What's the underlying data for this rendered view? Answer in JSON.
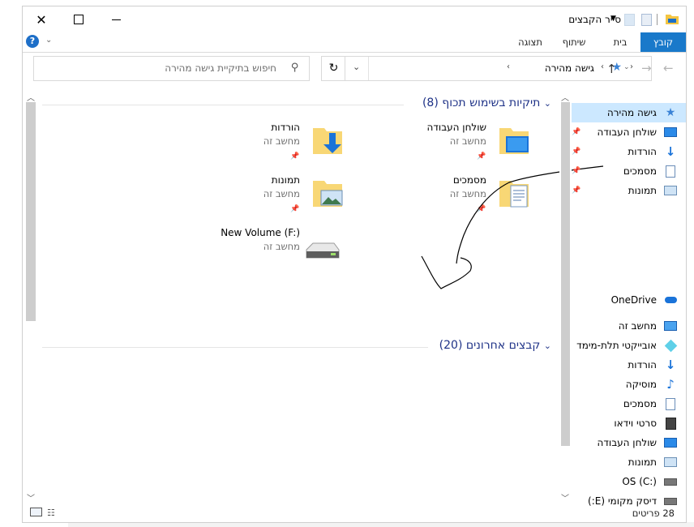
{
  "window": {
    "title": "סייר הקבצים",
    "caption": {
      "minimize": "—",
      "maximize": "☐",
      "close": "✕"
    }
  },
  "ribbon": {
    "tabs": [
      "קובץ",
      "בית",
      "שיתוף",
      "תצוגה"
    ],
    "help_glyph": "?"
  },
  "address": {
    "path_root": "גישה מהירה",
    "search_placeholder": "חיפוש בתיקיית גישה מהירה"
  },
  "groups": {
    "frequent": {
      "title": "תיקיות בשימוש תכוף (8)"
    },
    "recent": {
      "title": "קבצים אחרונים (20)"
    }
  },
  "tiles": [
    {
      "name": "שולחן העבודה",
      "sub": "מחשב זה",
      "icon": "desktop-folder-icon"
    },
    {
      "name": "הורדות",
      "sub": "מחשב זה",
      "icon": "downloads-folder-icon"
    },
    {
      "name": "מסמכים",
      "sub": "מחשב זה",
      "icon": "documents-folder-icon"
    },
    {
      "name": "תמונות",
      "sub": "מחשב זה",
      "icon": "pictures-folder-icon"
    },
    {
      "name": "New Volume (F:)",
      "sub": "מחשב זה",
      "icon": "drive-icon"
    }
  ],
  "nav": {
    "quick_access": "גישה מהירה",
    "quick_items": [
      "שולחן העבודה",
      "הורדות",
      "מסמכים",
      "תמונות"
    ],
    "onedrive": "OneDrive",
    "this_pc": "מחשב זה",
    "pc_items": [
      "אובייקטי תלת-מימד",
      "הורדות",
      "מוסיקה",
      "מסמכים",
      "סרטי וידאו",
      "שולחן העבודה",
      "תמונות",
      "OS (C:)",
      "דיסק מקומי (E:)"
    ]
  },
  "status": {
    "count": "28 פריטים"
  },
  "colors": {
    "accent": "#1979ca",
    "header": "#1e3287",
    "selection": "#cce8ff"
  }
}
